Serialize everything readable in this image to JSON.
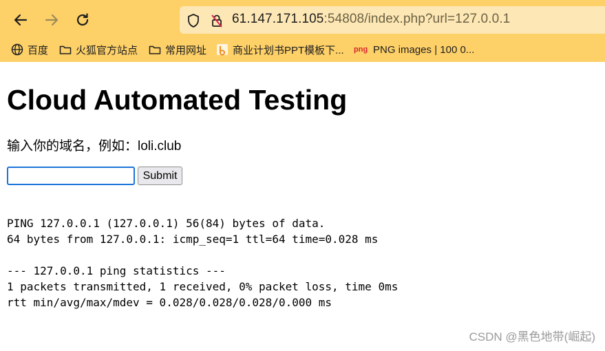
{
  "browser": {
    "url": {
      "host": "61.147.171.105",
      "port_path": ":54808/index.php?url=127.0.0.1"
    },
    "bookmarks": [
      {
        "label": "百度",
        "icon": "globe-icon"
      },
      {
        "label": "火狐官方站点",
        "icon": "folder-icon"
      },
      {
        "label": "常用网址",
        "icon": "folder-icon"
      },
      {
        "label": "商业计划书PPT模板下...",
        "icon": "doc-favicon-icon"
      },
      {
        "label": "PNG images | 100 0...",
        "icon": "png-favicon-icon",
        "badge": "png"
      }
    ]
  },
  "page": {
    "title": "Cloud Automated Testing",
    "prompt": "输入你的域名，例如：loli.club",
    "input_value": "",
    "submit_label": "Submit",
    "output_lines": [
      "PING 127.0.0.1 (127.0.0.1) 56(84) bytes of data.",
      "64 bytes from 127.0.0.1: icmp_seq=1 ttl=64 time=0.028 ms",
      "",
      "--- 127.0.0.1 ping statistics ---",
      "1 packets transmitted, 1 received, 0% packet loss, time 0ms",
      "rtt min/avg/max/mdev = 0.028/0.028/0.028/0.000 ms"
    ]
  },
  "watermark": "CSDN @黑色地带(崛起)",
  "colors": {
    "toolbar": "#fdd068",
    "url_bar": "#fde7b4",
    "input_focus": "#1a73d9"
  }
}
